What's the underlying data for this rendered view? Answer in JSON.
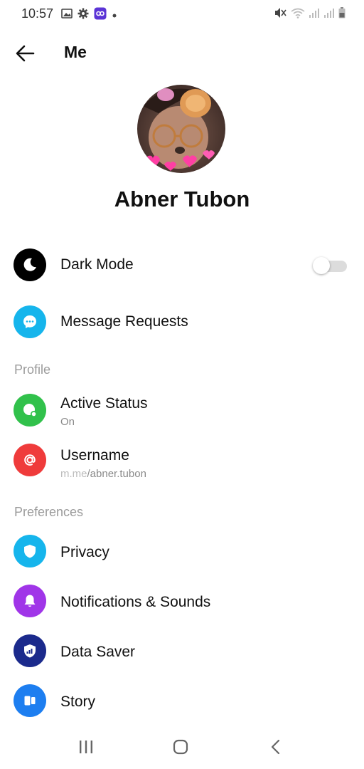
{
  "status_bar": {
    "time": "10:57",
    "left_icons": [
      "gallery-icon",
      "settings-gear-icon",
      "app-badge-icon",
      "dot-icon"
    ],
    "right_icons": [
      "mute-icon",
      "wifi-icon",
      "signal-icon",
      "signal-icon",
      "battery-icon"
    ]
  },
  "header": {
    "title": "Me",
    "back_icon": "arrow-left-icon"
  },
  "profile": {
    "name": "Abner Tubon"
  },
  "toggles": {
    "dark_mode_on": false
  },
  "rows": {
    "dark_mode": {
      "label": "Dark Mode",
      "icon": "moon-icon",
      "color": "#000000"
    },
    "message_requests": {
      "label": "Message Requests",
      "icon": "chat-bubble-icon",
      "color": "#16b5ec"
    },
    "active_status": {
      "label": "Active Status",
      "sub": "On",
      "icon": "active-status-icon",
      "color": "#31c14b"
    },
    "username": {
      "label": "Username",
      "sub_prefix": "m.me",
      "sub_value": "/abner.tubon",
      "icon": "at-sign-icon",
      "color": "#ef3b3b"
    },
    "privacy": {
      "label": "Privacy",
      "icon": "shield-icon",
      "color": "#16b5ec"
    },
    "notifications": {
      "label": "Notifications & Sounds",
      "icon": "bell-icon",
      "color": "#a035e8"
    },
    "data_saver": {
      "label": "Data Saver",
      "icon": "data-saver-icon",
      "color": "#1b2a8c"
    },
    "story": {
      "label": "Story",
      "icon": "story-icon",
      "color": "#1d7ef0"
    }
  },
  "sections": {
    "profile": "Profile",
    "preferences": "Preferences"
  },
  "nav_bar": {
    "recents_icon": "recents-icon",
    "home_icon": "home-icon",
    "back_icon": "back-chevron-icon"
  }
}
